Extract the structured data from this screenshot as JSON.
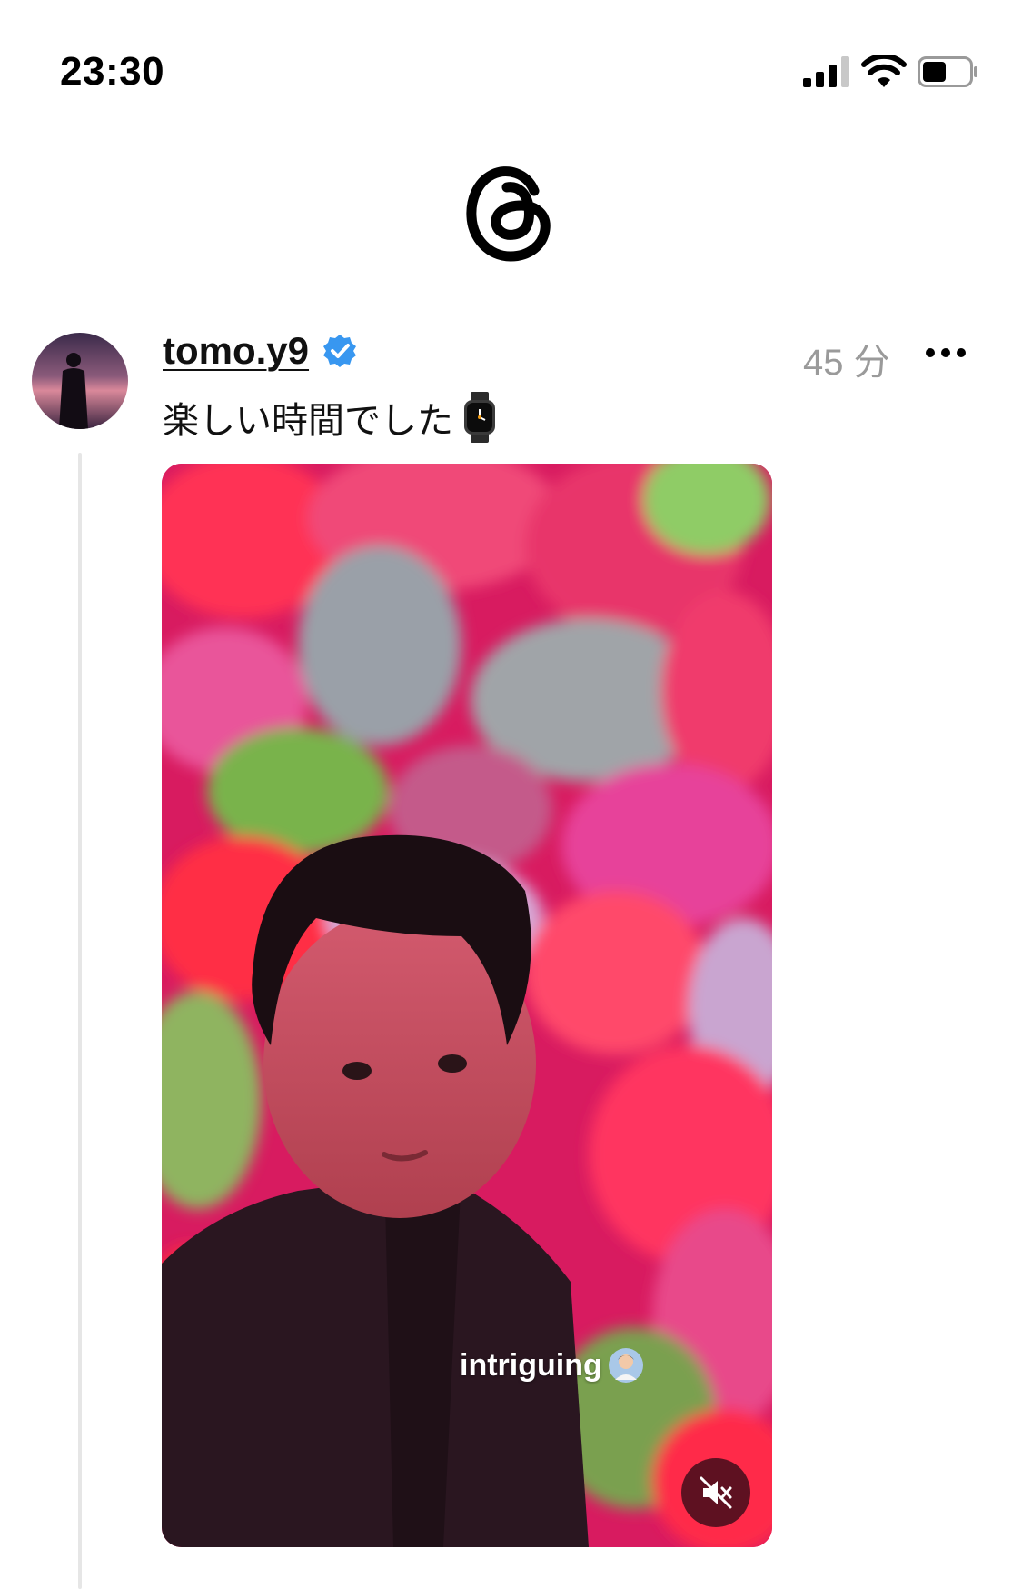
{
  "status_bar": {
    "time": "23:30",
    "battery_level": 0.5
  },
  "app": {
    "logo_icon": "threads-logo-icon"
  },
  "post": {
    "username": "tomo.y9",
    "verified": true,
    "timestamp": "45 分",
    "caption": "楽しい時間でした",
    "caption_emoji": "watch-emoji",
    "media": {
      "type": "video",
      "sticker_text": "intriguing",
      "sticker_emoji": "man-emoji",
      "muted": true
    }
  },
  "colors": {
    "verified_blue": "#3897f0",
    "timestamp_gray": "#9a9a9a",
    "thread_line": "#e6e6e6"
  }
}
